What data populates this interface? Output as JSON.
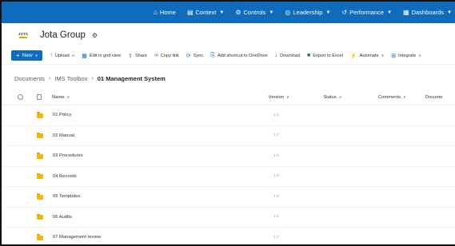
{
  "topnav": {
    "items": [
      {
        "label": "Home",
        "icon": "home-icon",
        "caret": false
      },
      {
        "label": "Context",
        "icon": "context-icon",
        "caret": true
      },
      {
        "label": "Controls",
        "icon": "controls-icon",
        "caret": true
      },
      {
        "label": "Leadership",
        "icon": "leadership-icon",
        "caret": true
      },
      {
        "label": "Performance",
        "icon": "performance-icon",
        "caret": true
      },
      {
        "label": "Dashboards",
        "icon": "dashboards-icon",
        "caret": true
      }
    ],
    "color": "#0f6cbd"
  },
  "site": {
    "logo_text": "JOTA",
    "title": "Jota Group"
  },
  "command_bar": {
    "new_label": "New",
    "commands": [
      {
        "label": "Upload",
        "icon": "upload-icon",
        "dropdown": true
      },
      {
        "label": "Edit in grid view",
        "icon": "grid-icon",
        "dropdown": false
      },
      {
        "label": "Share",
        "icon": "share-icon",
        "dropdown": false
      },
      {
        "label": "Copy link",
        "icon": "link-icon",
        "dropdown": false
      },
      {
        "label": "Sync",
        "icon": "sync-icon",
        "dropdown": false
      },
      {
        "label": "Add shortcut to OneDrive",
        "icon": "shortcut-icon",
        "dropdown": false
      },
      {
        "label": "Download",
        "icon": "download-icon",
        "dropdown": false
      },
      {
        "label": "Export to Excel",
        "icon": "excel-icon",
        "dropdown": false
      },
      {
        "label": "Automate",
        "icon": "automate-icon",
        "dropdown": true
      },
      {
        "label": "Integrate",
        "icon": "integrate-icon",
        "dropdown": true
      }
    ]
  },
  "breadcrumb": {
    "items": [
      "Documents",
      "IMS Toolbox"
    ],
    "current": "01 Management System"
  },
  "table": {
    "headers": {
      "name": "Name",
      "version": "Version",
      "status": "Status",
      "comments": "Comments",
      "document": "Docume"
    },
    "rows": [
      {
        "name": "01 Policy",
        "version": "1.0"
      },
      {
        "name": "02 Manual",
        "version": "1.0"
      },
      {
        "name": "03 Procedures",
        "version": "1.0"
      },
      {
        "name": "04 Records",
        "version": "1.0"
      },
      {
        "name": "05 Templates",
        "version": "1.0"
      },
      {
        "name": "06 Audits",
        "version": "1.0"
      },
      {
        "name": "07 Management review",
        "version": "1.0"
      }
    ]
  }
}
